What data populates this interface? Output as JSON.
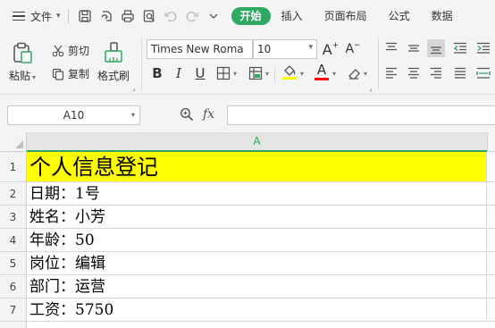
{
  "menu": {
    "file_label": "文件",
    "tabs": [
      "开始",
      "插入",
      "页面布局",
      "公式",
      "数据"
    ]
  },
  "ribbon": {
    "paste_label": "粘贴",
    "cut_label": "剪切",
    "copy_label": "复制",
    "format_painter_label": "格式刷",
    "font_name": "Times New Roma",
    "font_size": "10",
    "accent_color": "#2fa862",
    "font_color_bar": "#ff0000",
    "fill_color_bar": "#ffff00"
  },
  "formula_bar": {
    "name_box": "A10",
    "fx_label": "fx",
    "formula_value": ""
  },
  "sheet": {
    "column_header": "A",
    "rows": [
      {
        "num": "1",
        "text": "个人信息登记"
      },
      {
        "num": "2",
        "text": "日期：1号"
      },
      {
        "num": "3",
        "text": "姓名：小芳"
      },
      {
        "num": "4",
        "text": "年龄：50"
      },
      {
        "num": "5",
        "text": "岗位：编辑"
      },
      {
        "num": "6",
        "text": "部门：运营"
      },
      {
        "num": "7",
        "text": "工资：5750"
      }
    ],
    "title_fill": "#ffff00"
  }
}
